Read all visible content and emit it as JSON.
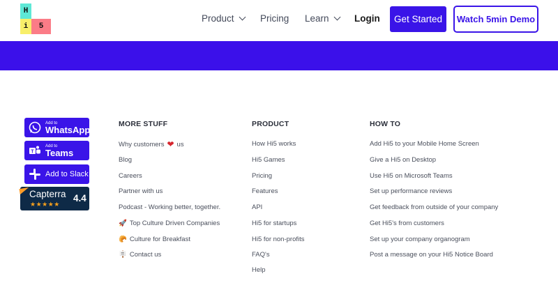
{
  "header": {
    "logo": {
      "h": "H",
      "i": "i",
      "five": "5"
    },
    "nav": {
      "product": "Product",
      "pricing": "Pricing",
      "learn": "Learn",
      "login": "Login"
    },
    "cta_primary": "Get Started",
    "cta_demo": "Watch 5min Demo"
  },
  "badges": {
    "whatsapp": {
      "small": "Add to",
      "big": "WhatsApp",
      "icon": "whatsapp-icon"
    },
    "teams": {
      "small": "Add to",
      "big": "Teams",
      "icon": "teams-icon"
    },
    "slack": {
      "big": "Add to Slack",
      "icon": "slack-icon"
    },
    "capterra": {
      "name": "Capterra",
      "stars": "★★★★★",
      "score": "4.4"
    }
  },
  "footer": {
    "more_stuff": {
      "title": "MORE STUFF",
      "items": [
        {
          "pre": "Why customers",
          "post": "us",
          "icon": "heart-icon"
        },
        {
          "label": "Blog"
        },
        {
          "label": "Careers"
        },
        {
          "label": "Partner with us"
        },
        {
          "label": "Podcast - Working better, together."
        },
        {
          "label": "Top Culture Driven Companies",
          "icon": "rocket-icon"
        },
        {
          "label": "Culture for Breakfast",
          "icon": "food-icon"
        },
        {
          "label": "Contact us",
          "icon": "signpost-icon"
        }
      ]
    },
    "product": {
      "title": "PRODUCT",
      "items": [
        "How Hi5 works",
        "Hi5 Games",
        "Pricing",
        "Features",
        "API",
        "Hi5 for startups",
        "Hi5 for non-profits",
        "FAQ's",
        "Help"
      ]
    },
    "how_to": {
      "title": "HOW TO",
      "items": [
        "Add Hi5 to your Mobile Home Screen",
        "Give a Hi5 on Desktop",
        "Use Hi5 on Microsoft Teams",
        "Set up performance reviews",
        "Get feedback from outside of your company",
        "Get Hi5's from customers",
        "Set up your company organogram",
        "Post a message on your Hi5 Notice Board"
      ]
    }
  },
  "colors": {
    "brand": "#3a14e8",
    "banner": "#3b10ea",
    "capterra_bg": "#0e2a47"
  }
}
